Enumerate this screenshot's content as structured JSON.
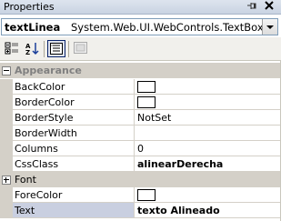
{
  "window": {
    "title": "Properties",
    "pin_icon": "pin-icon",
    "close_icon": "close-icon"
  },
  "selector": {
    "name": "textLinea",
    "type": "System.Web.UI.WebControls.TextBox"
  },
  "toolbar": {
    "categorized_icon": "categorized-icon",
    "alphabetical_icon": "alphabetical-icon",
    "properties_icon": "properties-icon",
    "events_icon": "events-icon"
  },
  "categories": [
    {
      "label": "Appearance",
      "expanded": true
    },
    {
      "label": "Font",
      "expanded": false
    }
  ],
  "properties": [
    {
      "name": "BackColor",
      "value": "",
      "swatch": "#ffffff"
    },
    {
      "name": "BorderColor",
      "value": "",
      "swatch": "#ffffff"
    },
    {
      "name": "BorderStyle",
      "value": "NotSet"
    },
    {
      "name": "BorderWidth",
      "value": ""
    },
    {
      "name": "Columns",
      "value": "0"
    },
    {
      "name": "CssClass",
      "value": "alinearDerecha",
      "bold": true
    },
    {
      "name": "ForeColor",
      "value": "",
      "swatch": "#ffffff"
    },
    {
      "name": "Text",
      "value": "texto Alineado",
      "bold": true,
      "selected": true
    }
  ]
}
